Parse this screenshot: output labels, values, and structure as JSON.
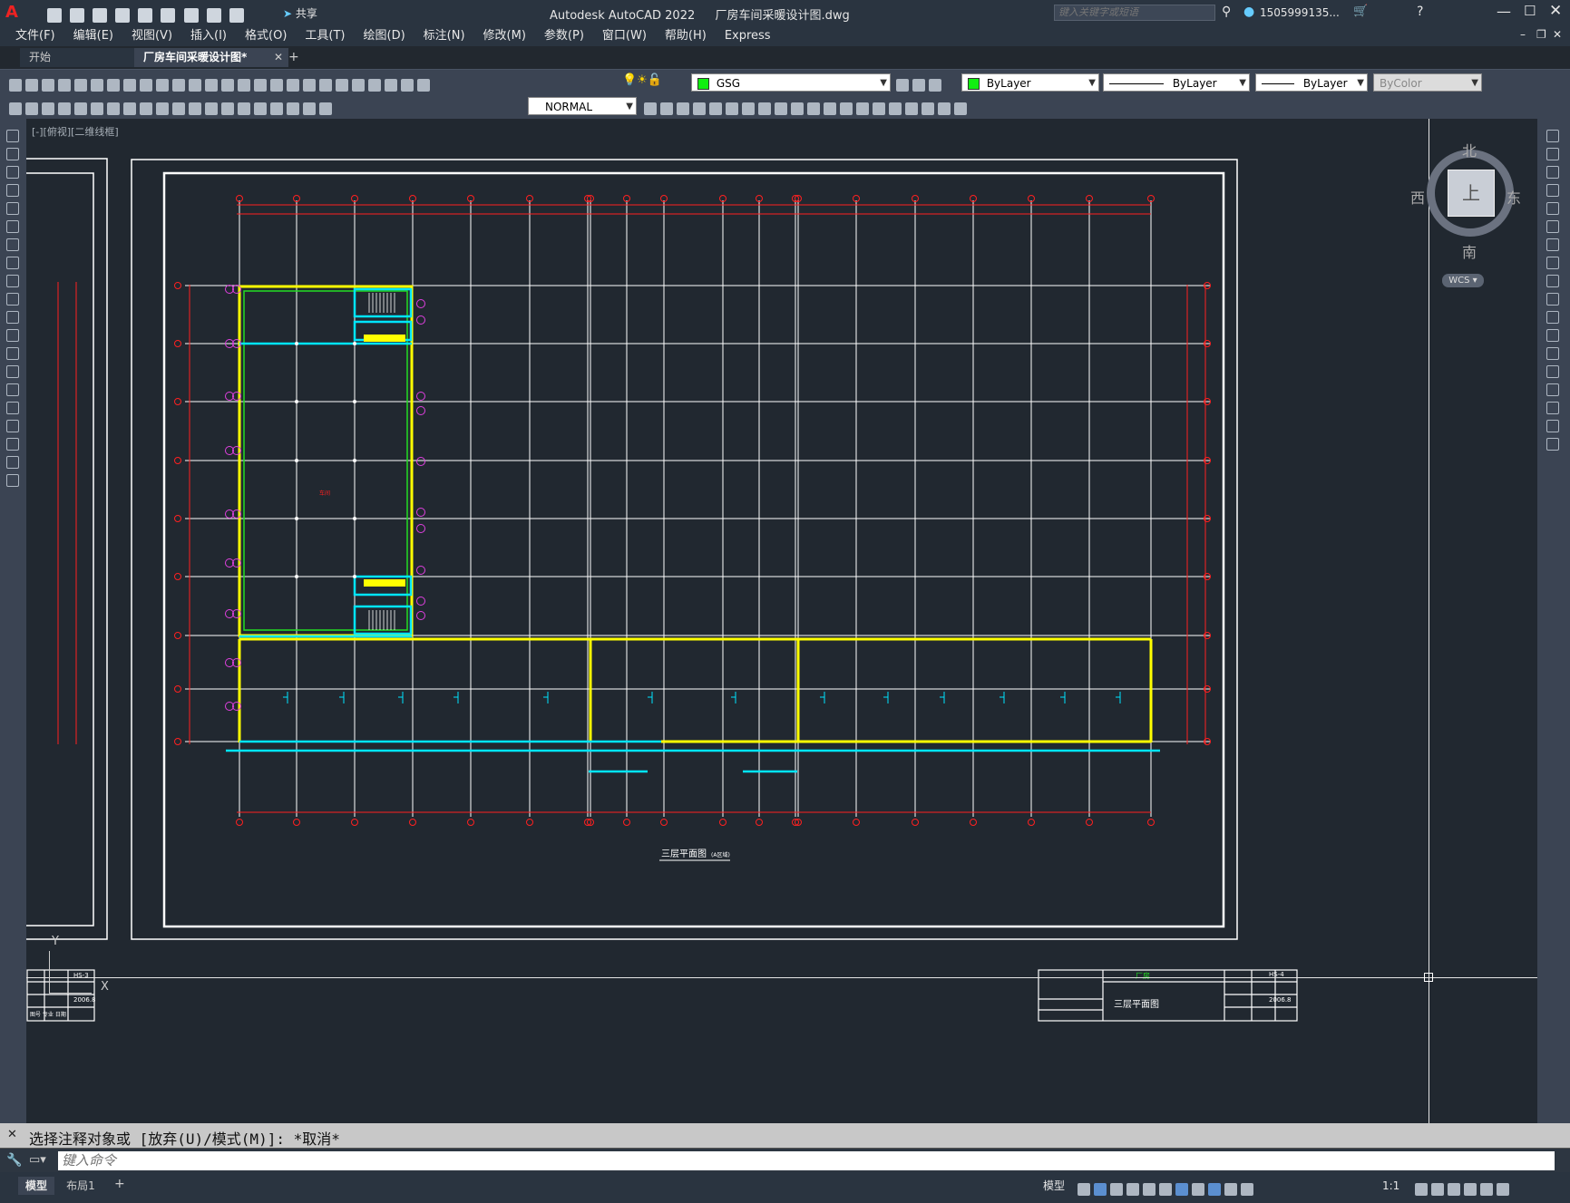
{
  "titlebar": {
    "app_title": "Autodesk AutoCAD 2022",
    "file_title": "厂房车间采暖设计图.dwg",
    "share_label": "共享",
    "search_placeholder": "键入关键字或短语",
    "user": "1505999135..."
  },
  "menu": [
    "文件(F)",
    "编辑(E)",
    "视图(V)",
    "插入(I)",
    "格式(O)",
    "工具(T)",
    "绘图(D)",
    "标注(N)",
    "修改(M)",
    "参数(P)",
    "窗口(W)",
    "帮助(H)",
    "Express"
  ],
  "tabs": [
    {
      "label": "开始",
      "active": false
    },
    {
      "label": "厂房车间采暖设计图*",
      "active": true
    }
  ],
  "toolbar": {
    "layer_value": "GSG",
    "color_value": "ByLayer",
    "linetype_value": "ByLayer",
    "lineweight_value": "ByLayer",
    "plotstyle_value": "ByColor",
    "dimstyle_value": "NORMAL"
  },
  "viewport": {
    "label": "[-][俯视][二维线框]",
    "viewcube": {
      "north": "北",
      "south": "南",
      "east": "东",
      "west": "西",
      "top": "上"
    },
    "wcs_label": "WCS"
  },
  "drawing": {
    "title": "三层平面图",
    "title_note": "(A区域)",
    "room_label": "车间",
    "titleblock_left": {
      "sheet": "HS-3",
      "date": "2006.8",
      "note": "图号 专业 日期"
    },
    "titleblock_right": {
      "company": "厂房",
      "sheet_title": "三层平面图",
      "sheet_no": "HS-4",
      "date": "2006.8"
    },
    "ucs_x": "X",
    "ucs_y": "Y"
  },
  "command": {
    "history": "选择注释对象或 [放弃(U)/模式(M)]: *取消*",
    "placeholder": "键入命令"
  },
  "status": {
    "tabs": [
      {
        "label": "模型",
        "active": true
      },
      {
        "label": "布局1",
        "active": false
      }
    ],
    "model_label": "模型",
    "scale": "1:1"
  },
  "colors": {
    "canvas_bg": "#212830",
    "grid": "#ffffff",
    "axis_red": "#ff2020",
    "wall_yellow": "#ffff00",
    "wall_cyan": "#00e5ff",
    "green": "#22dd22",
    "magenta": "#e040e0"
  }
}
